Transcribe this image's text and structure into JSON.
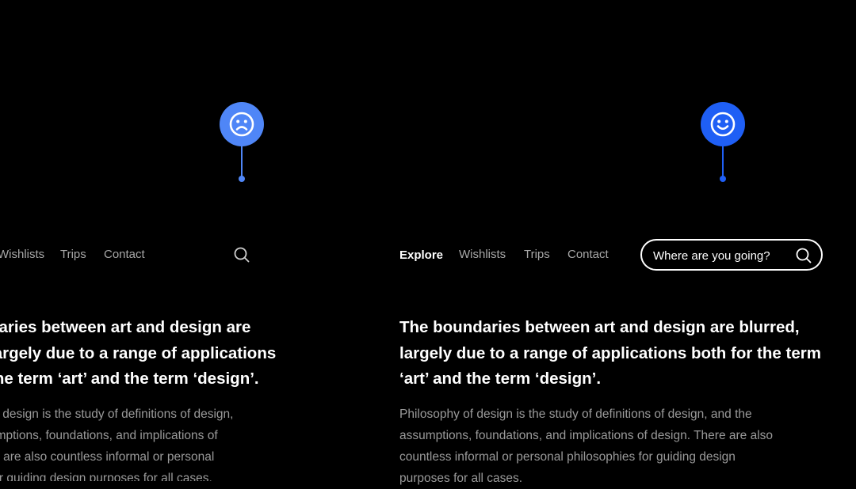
{
  "colors": {
    "background": "#000000",
    "sad_marker": "#4f86f7",
    "happy_marker": "#1f5ff5",
    "nav_text": "#a8a8a8",
    "body_text": "#9a9a9a"
  },
  "left_panel": {
    "marker_icon": "sad-face-icon",
    "nav": {
      "items": [
        {
          "label": "Wishlists"
        },
        {
          "label": "Trips"
        },
        {
          "label": "Contact"
        }
      ],
      "search_icon": "search-icon"
    },
    "headline_lines": [
      "daries between art and design are",
      "largely due to a range of applications",
      "the term ‘art’ and the term ‘design’."
    ],
    "body_lines": [
      "of design is the study of definitions of design,",
      "umptions, foundations, and implications of",
      "re are also countless informal or personal",
      "for guiding design purposes for all cases."
    ]
  },
  "right_panel": {
    "marker_icon": "happy-face-icon",
    "nav": {
      "items": [
        {
          "label": "Explore",
          "active": true
        },
        {
          "label": "Wishlists"
        },
        {
          "label": "Trips"
        },
        {
          "label": "Contact"
        }
      ],
      "search_placeholder": "Where are you going?",
      "search_icon": "search-icon"
    },
    "headline_lines": [
      "The boundaries between art and design are blurred,",
      "largely due to a range of applications both for the term",
      "‘art’ and the term ‘design’."
    ],
    "body_lines": [
      "Philosophy of design is the study of definitions of design, and the",
      "assumptions, foundations, and implications of design. There are also",
      "countless informal or personal philosophies for guiding design",
      "purposes for all cases."
    ]
  }
}
